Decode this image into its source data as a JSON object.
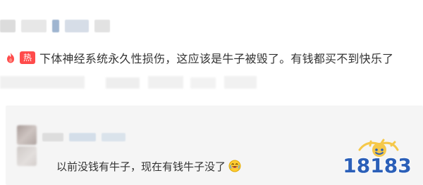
{
  "hot_comment": {
    "badge_label": "热",
    "text": "下体神经系统永久性损伤，这应该是牛子被毁了。有钱都买不到快乐了"
  },
  "reply": {
    "text": "以前没钱有牛子，现在有钱牛子没了"
  },
  "icons": {
    "hot": "flame-icon",
    "emoji": "laugh-emoji-icon"
  },
  "watermark": {
    "text": "18183"
  },
  "colors": {
    "hot_badge": "#ff4b4b",
    "text": "#333333",
    "reply_bg": "#f5f5f5",
    "watermark_blue": "#2b5fb8",
    "watermark_yellow": "#f5c84a"
  }
}
